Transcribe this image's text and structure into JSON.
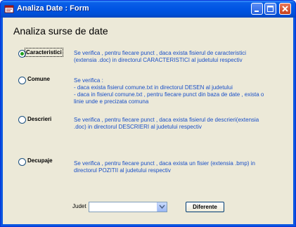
{
  "window": {
    "title": "Analiza Date : Form"
  },
  "heading": "Analiza surse de date",
  "options": [
    {
      "label": "Caracteristici",
      "selected": true,
      "description": [
        "Se verifica , pentru fiecare punct , daca exista fisierul de caracteristici",
        "(extensia .doc) in directorul CARACTERISTICI al judetului respectiv"
      ]
    },
    {
      "label": "Comune",
      "selected": false,
      "description": [
        "Se verifica  :",
        "- daca exista fisierul comune.txt in directorul DESEN al judetului",
        "- daca in fisierul comune.txt , pentru fiecare punct din baza de date , exista o",
        "linie unde e precizata comuna"
      ]
    },
    {
      "label": "Descrieri",
      "selected": false,
      "description": [
        "Se verifica , pentru fiecare punct , daca exista fisierul de descrieri(extensia",
        ".doc) in directorul DESCRIERI al judetului respectiv"
      ]
    },
    {
      "label": "Decupaje",
      "selected": false,
      "description": [
        "Se verifica , pentru fiecare punct , daca exista un fisier (extensia .bmp) in",
        "directorul POZITII al judetului respectiv"
      ]
    }
  ],
  "filter": {
    "label": "Judet",
    "value": ""
  },
  "diferente_button": "Diferente",
  "colors": {
    "titlebar": "#0054e3",
    "client_bg": "#ece9d8",
    "description_text": "#1a50c8",
    "radio_dot": "#21a121"
  }
}
